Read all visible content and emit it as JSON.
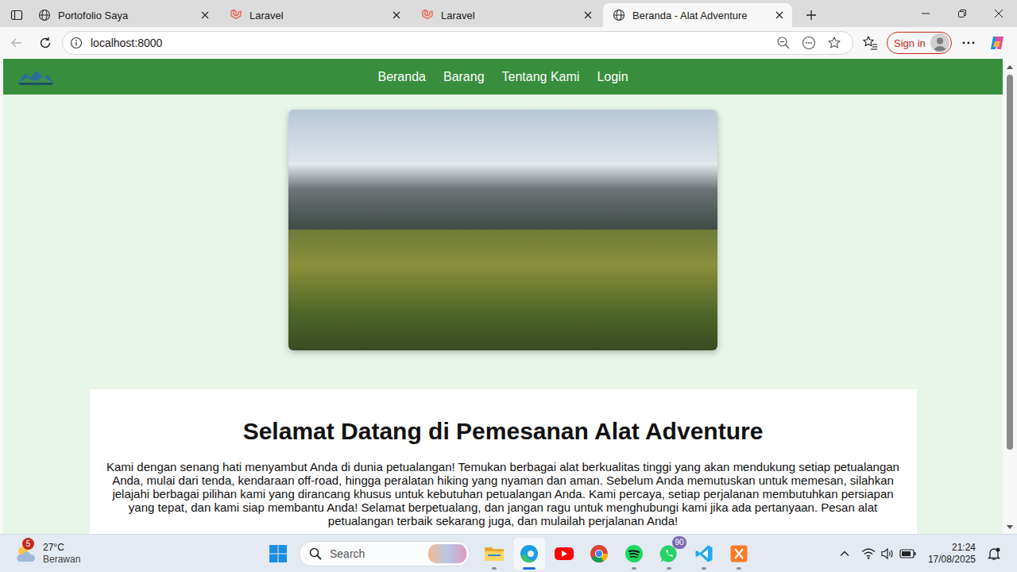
{
  "tabs": [
    {
      "label": "Portofolio Saya",
      "icon": "globe",
      "selected": false
    },
    {
      "label": "Laravel",
      "icon": "laravel",
      "selected": false
    },
    {
      "label": "Laravel",
      "icon": "laravel",
      "selected": false
    },
    {
      "label": "Beranda - Alat Adventure",
      "icon": "globe",
      "selected": true
    }
  ],
  "address": "localhost:8000",
  "sign_in": "Sign in",
  "page": {
    "nav": [
      "Beranda",
      "Barang",
      "Tentang Kami",
      "Login"
    ],
    "heading": "Selamat Datang di Pemesanan Alat Adventure",
    "paragraph": "Kami dengan senang hati menyambut Anda di dunia petualangan! Temukan berbagai alat berkualitas tinggi yang akan mendukung setiap petualangan Anda, mulai dari tenda, kendaraan off-road, hingga peralatan hiking yang nyaman dan aman. Sebelum Anda memutuskan untuk memesan, silahkan jelajahi berbagai pilihan kami yang dirancang khusus untuk kebutuhan petualangan Anda. Kami percaya, setiap perjalanan membutuhkan persiapan yang tepat, dan kami siap membantu Anda! Selamat berpetualang, dan jangan ragu untuk menghubungi kami jika ada pertanyaan. Pesan alat petualangan terbaik sekarang juga, dan mulailah perjalanan Anda!"
  },
  "scrollbar": {
    "level": 0.84
  },
  "taskbar": {
    "weather": {
      "badge": "5",
      "temperature": "27°C",
      "condition": "Berawan"
    },
    "search": {
      "placeholder": "Search"
    },
    "apps": [
      {
        "kind": "explorer",
        "running": true,
        "selected": false
      },
      {
        "kind": "edge",
        "running": true,
        "selected": true
      },
      {
        "kind": "youtube",
        "running": false,
        "selected": false
      },
      {
        "kind": "chrome",
        "running": false,
        "selected": false
      },
      {
        "kind": "spotify",
        "running": true,
        "selected": false
      },
      {
        "kind": "whatsapp",
        "running": true,
        "selected": false,
        "badge": "90"
      },
      {
        "kind": "vscode",
        "running": true,
        "selected": false
      },
      {
        "kind": "xampp",
        "running": true,
        "selected": false
      }
    ],
    "time": "21:24",
    "date": "17/08/2025"
  }
}
